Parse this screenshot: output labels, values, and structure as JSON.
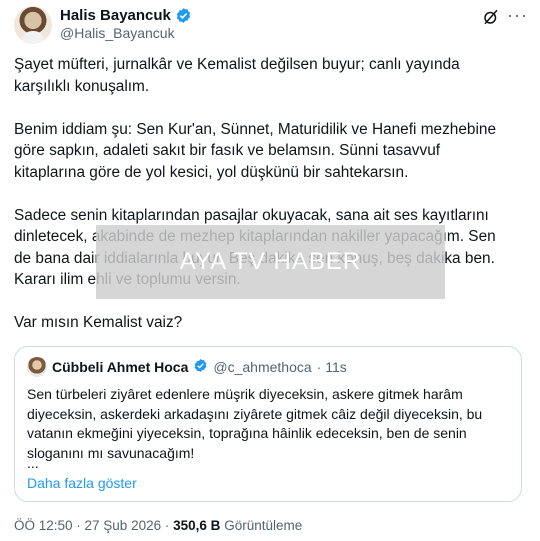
{
  "author": {
    "display_name": "Halis Bayancuk",
    "handle": "@Halis_Bayancuk"
  },
  "tweet": {
    "paragraphs": [
      "Şayet müfteri, jurnalkâr ve Kemalist değilsen buyur; canlı yayında karşılıklı konuşalım.",
      "Benim iddiam şu: Sen Kur'an, Sünnet, Maturidilik ve Hanefi mezhebine göre sapkın, adaleti sakıt bir fasık ve belamsın. Sünni tasavvuf kitaplarına göre de yol kesici, yol düşkünü bir sahtekarsın.",
      "Sadece senin  kitaplarından pasajlar okuyacak, sana ait ses kayıtlarını dinletecek, akabinde de mezhep kitaplarından nakiller yapacağım. Sen de bana dair iddialarınla buyur. Beş dakika sen konuş, beş dakika ben. Kararı ilim ehli ve toplumu versin.",
      "Var mısın Kemalist vaiz?"
    ]
  },
  "watermark": {
    "text": "AYA TV HABER"
  },
  "quoted_tweet": {
    "display_name": "Cübbeli Ahmet Hoca",
    "handle": "@c_ahmethoca",
    "time": "· 11s",
    "text": "Sen türbeleri ziyâret edenlere müşrik diyeceksin, askere gitmek harâm diyeceksin, askerdeki arkadaşını ziyârete gitmek câiz değil diyeceksin, bu vatanın ekmeğini yiyeceksin, toprağına hâinlik edeceksin, ben de senin sloganını mı savunacağım!",
    "ellipsis": "...",
    "show_more": "Daha fazla göster"
  },
  "footer": {
    "time_date": "ÖÖ 12:50 · 27 Şub 2026 ·",
    "views_count": "350,6 B",
    "views_label": "Görüntüleme"
  },
  "colors": {
    "accent": "#1d9bf0",
    "muted": "#536471",
    "text": "#0f1419",
    "border": "#cfd9de"
  },
  "icons": [
    "verified-badge-icon",
    "grok-icon",
    "more-icon"
  ]
}
